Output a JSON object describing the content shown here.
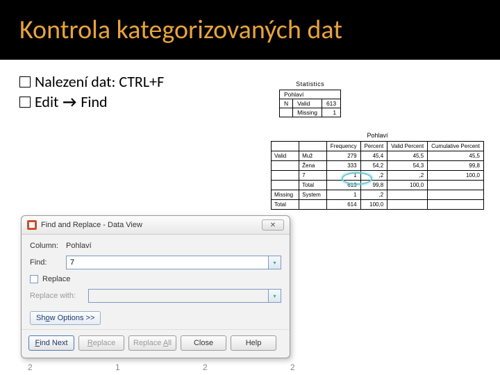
{
  "title": "Kontrola kategorizovaných dat",
  "bullets": {
    "b1a": "Nalezení dat: CTRL+F",
    "b2a": "Edit",
    "b2arrow": "→",
    "b2b": "Find"
  },
  "stats": {
    "heading": "Statistics",
    "var": "Pohlaví",
    "rows": [
      {
        "k1": "N",
        "k2": "Valid",
        "v": "613"
      },
      {
        "k1": "",
        "k2": "Missing",
        "v": "1"
      }
    ]
  },
  "freq": {
    "heading": "Pohlaví",
    "cols": [
      "",
      "",
      "Frequency",
      "Percent",
      "Valid Percent",
      "Cumulative Percent"
    ],
    "rows": [
      {
        "g": "Valid",
        "lbl": "Muž",
        "f": "279",
        "p": "45,4",
        "vp": "45,5",
        "cp": "45,5"
      },
      {
        "g": "",
        "lbl": "Žena",
        "f": "333",
        "p": "54,2",
        "vp": "54,3",
        "cp": "99,8"
      },
      {
        "g": "",
        "lbl": "7",
        "f": "1",
        "p": ",2",
        "vp": ",2",
        "cp": "100,0"
      },
      {
        "g": "",
        "lbl": "Total",
        "f": "613",
        "p": "99,8",
        "vp": "100,0",
        "cp": ""
      },
      {
        "g": "Missing",
        "lbl": "System",
        "f": "1",
        "p": ",2",
        "vp": "",
        "cp": ""
      },
      {
        "g": "Total",
        "lbl": "",
        "f": "614",
        "p": "100,0",
        "vp": "",
        "cp": ""
      }
    ]
  },
  "dialog": {
    "title": "Find and Replace - Data View",
    "column_label": "Column:",
    "column_value": "Pohlaví",
    "find_label": "Find:",
    "find_value": "7",
    "replace_cb": "Replace",
    "replace_with": "Replace with:",
    "show_options": {
      "pre": "Sh",
      "ul": "o",
      "post": "w Options >>"
    },
    "buttons": {
      "find_next": {
        "ul": "F",
        "rest": "ind Next"
      },
      "replace": {
        "ul": "R",
        "rest": "eplace"
      },
      "replace_all": {
        "pre": "Replace ",
        "ul": "A",
        "post": "ll"
      },
      "close": "Close",
      "help": "Help"
    }
  },
  "bg": "2        1        2        2"
}
